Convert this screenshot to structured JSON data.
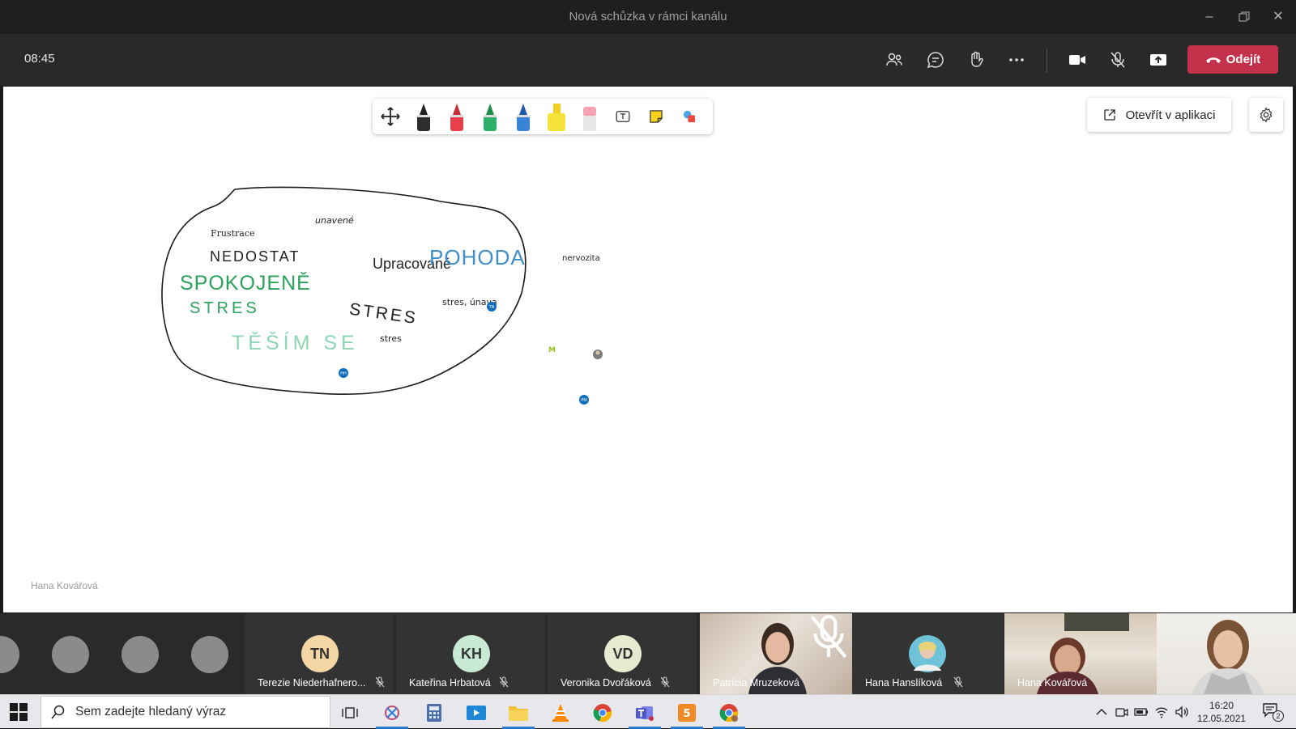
{
  "window": {
    "title": "Nová schůzka v rámci kanálu",
    "minimize_icon": "minimize-icon",
    "restore_icon": "restore-icon",
    "close_icon": "close-icon"
  },
  "meeting": {
    "timer": "08:45",
    "leave_label": "Odejít",
    "leave_color": "#c4314b",
    "controls": [
      "people-icon",
      "chat-icon",
      "raise-hand-icon",
      "more-icon",
      "camera-icon",
      "mic-off-icon",
      "share-icon"
    ]
  },
  "whiteboard": {
    "tools": [
      "pan-icon",
      "black-pen",
      "red-pen",
      "green-pen",
      "blue-pen",
      "yellow-highlighter",
      "eraser",
      "text-icon",
      "sticky-note-icon",
      "shapes-icon"
    ],
    "open_in_app_label": "Otevřít v aplikaci",
    "presenter_name": "Hana Kovářová",
    "words": {
      "frustrace": "Frustrace",
      "unavene": "unavené",
      "nedostat": "NEDOSTAT",
      "spokojene": "SPOKOJENĚ",
      "stres_green": "STRES",
      "tesim_se": "TĚŠÍM SE",
      "upracovane": "Upracované",
      "pohoda": "POHODA",
      "stres_big": "STRES",
      "stres_unava": "stres, únava",
      "stres_small": "stres",
      "nervozita": "nervozita",
      "cursor_tn": "TN",
      "cursor_hh": "HH",
      "cursor_pm": "PM",
      "cursor_m": "M"
    }
  },
  "participants": [
    {
      "initials": "TN",
      "name": "Terezie Niederhafnero...",
      "avatar_color": "#f3d6a4",
      "muted": true
    },
    {
      "initials": "KH",
      "name": "Kateřina Hrbatová",
      "avatar_color": "#c8ead5",
      "muted": true
    },
    {
      "initials": "VD",
      "name": "Veronika Dvořáková",
      "avatar_color": "#e6ead0",
      "muted": true
    },
    {
      "initials": "",
      "name": "Patrícia Mruzeková",
      "video": true,
      "muted": true
    },
    {
      "initials": "",
      "name": "Hana Hanslíková",
      "photo": true,
      "muted": true
    },
    {
      "initials": "",
      "name": "Hana Kovářová",
      "video": true,
      "muted": false
    }
  ],
  "taskbar": {
    "search_placeholder": "Sem zadejte hledaný výraz",
    "time": "16:20",
    "date": "12.05.2021",
    "notification_count": "2",
    "apps": [
      "task-view-icon",
      "snip-icon",
      "calculator-icon",
      "media-player-icon",
      "file-explorer-icon",
      "vlc-icon",
      "chrome-icon",
      "teams-icon",
      "app-icon",
      "chrome-profile-icon"
    ]
  }
}
